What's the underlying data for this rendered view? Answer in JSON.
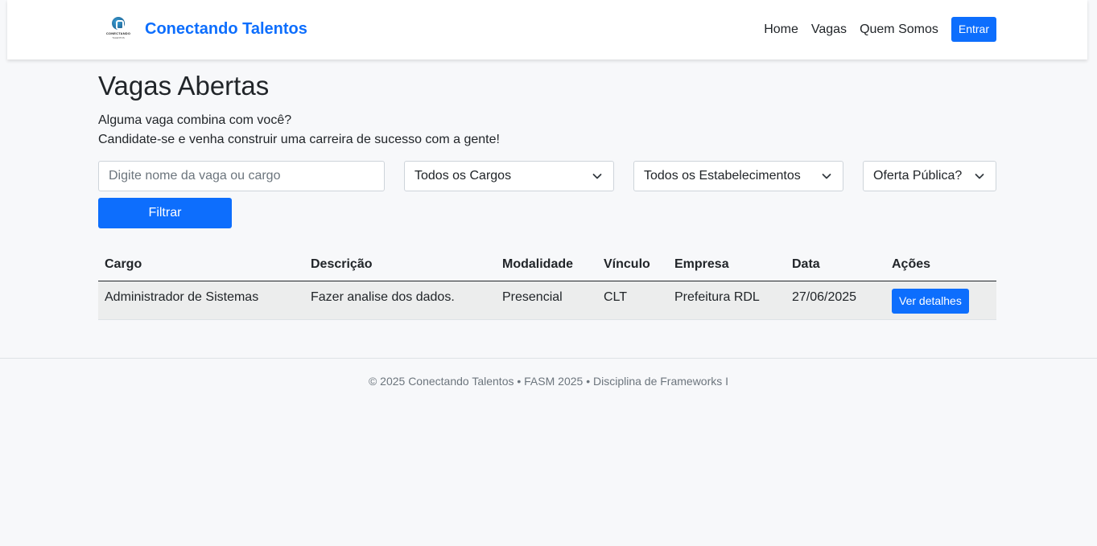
{
  "navbar": {
    "logo_text_1": "CONECTANDO",
    "logo_text_2": "TALENTOS",
    "brand": "Conectando Talentos",
    "links": [
      "Home",
      "Vagas",
      "Quem Somos"
    ],
    "login_label": "Entrar"
  },
  "page": {
    "title": "Vagas Abertas",
    "intro_line_1": "Alguma vaga combina com você?",
    "intro_line_2": "Candidate-se e venha construir uma carreira de sucesso com a gente!"
  },
  "filters": {
    "search_placeholder": "Digite nome da vaga ou cargo",
    "search_value": "",
    "cargo_selected": "Todos os Cargos",
    "estabelecimento_selected": "Todos os Estabelecimentos",
    "oferta_selected": "Oferta Pública?",
    "filter_label": "Filtrar",
    "chevron_icon": "chevron-down-icon"
  },
  "table": {
    "headers": [
      "Cargo",
      "Descrição",
      "Modalidade",
      "Vínculo",
      "Empresa",
      "Data",
      "Ações"
    ],
    "rows": [
      {
        "cargo": "Administrador de Sistemas",
        "descricao": "Fazer analise dos dados.",
        "modalidade": "Presencial",
        "vinculo": "CLT",
        "empresa": "Prefeitura RDL",
        "data": "27/06/2025",
        "action_label": "Ver detalhes"
      }
    ]
  },
  "footer": {
    "text": "© 2025 Conectando Talentos • FASM 2025 • Disciplina de Frameworks I"
  },
  "colors": {
    "primary": "#0d6efd",
    "background": "#f7f8fa",
    "row_background": "#eceded"
  }
}
